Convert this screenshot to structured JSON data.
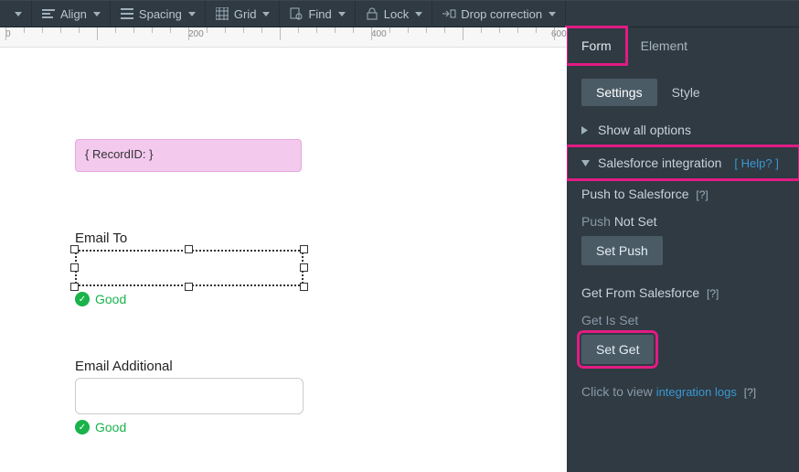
{
  "toolbar": {
    "align": "Align",
    "spacing": "Spacing",
    "grid": "Grid",
    "find": "Find",
    "lock": "Lock",
    "drop": "Drop correction"
  },
  "ruler": {
    "marks": [
      "0",
      "200",
      "400",
      "600"
    ]
  },
  "canvas": {
    "recordPill": "{ RecordID: }",
    "fields": [
      {
        "label": "Email To",
        "status": "Good"
      },
      {
        "label": "Email Additional",
        "status": "Good"
      }
    ]
  },
  "panel": {
    "tabs": [
      "Form",
      "Element"
    ],
    "subtabs": [
      "Settings",
      "Style"
    ],
    "showAll": "Show all options",
    "sf": {
      "title": "Salesforce integration",
      "help": "Help?",
      "pushLabel": "Push to Salesforce",
      "pushStatusKey": "Push",
      "pushStatusVal": "Not Set",
      "setPush": "Set Push",
      "getLabel": "Get From Salesforce",
      "getStatus": "Get Is Set",
      "setGet": "Set Get",
      "logsPrefix": "Click to view ",
      "logsLink": "integration logs"
    }
  }
}
